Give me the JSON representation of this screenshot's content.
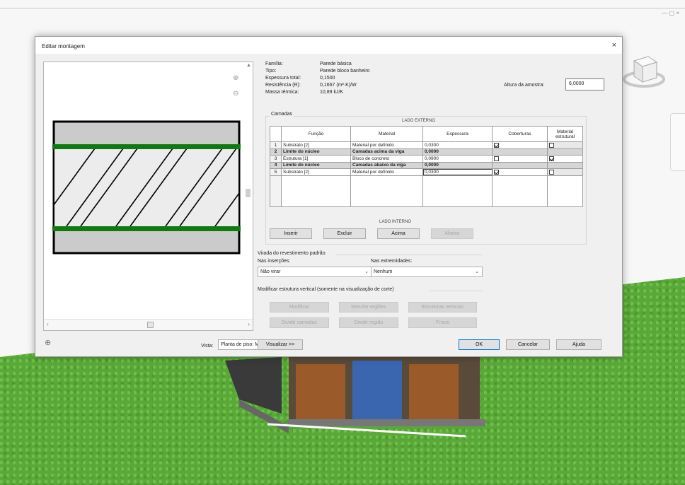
{
  "window": {
    "controls": "— ▢ ×"
  },
  "dialog": {
    "title": "Editar montagem",
    "close": "×"
  },
  "properties": {
    "labels": [
      "Família:",
      "Tipo:",
      "Espessura total:",
      "Resistência (R):",
      "Massa térmica:"
    ],
    "values": [
      "Parede básica",
      "Parede bloco banheiro",
      "0,1500",
      "0,1667 (m²·K)/W",
      "10,89 kJ/K"
    ],
    "sample_height_label": "Altura da amostra:",
    "sample_height_value": "6,0000"
  },
  "layers": {
    "group_label": "Camadas",
    "exterior_side": "LADO EXTERNO",
    "interior_side": "LADO INTERNO",
    "headers": [
      "",
      "Função",
      "Material",
      "Espessura",
      "Coberturas",
      "Material estrutural"
    ],
    "rows": [
      {
        "num": "1",
        "function": "Substrato [2]",
        "material": "Material por definido",
        "thickness": "0,0300",
        "wraps": true,
        "structural": false,
        "core": false
      },
      {
        "num": "2",
        "function": "Limite do núcleo",
        "material": "Camadas acima da viga",
        "thickness": "0,0000",
        "wraps": null,
        "structural": null,
        "core": true
      },
      {
        "num": "3",
        "function": "Estrutura [1]",
        "material": "Bloco de concreto",
        "thickness": "0,0900",
        "wraps": false,
        "structural": true,
        "core": false
      },
      {
        "num": "4",
        "function": "Limite do núcleo",
        "material": "Camadas abaixo da viga",
        "thickness": "0,0000",
        "wraps": null,
        "structural": null,
        "core": true
      },
      {
        "num": "5",
        "function": "Substrato [2]",
        "material": "Material por definido",
        "thickness": "0,0300",
        "wraps": true,
        "structural": false,
        "core": false
      }
    ],
    "buttons": {
      "insert": "Inserir",
      "delete": "Excluir",
      "up": "Acima",
      "down": "Abaixo"
    }
  },
  "wrapping": {
    "title": "Virada do revestimento padrão",
    "at_inserts_label": "Nas inserções:",
    "at_inserts_value": "Não virar",
    "at_ends_label": "Nas extremidades:",
    "at_ends_value": "Nenhum"
  },
  "vertical": {
    "title": "Modificar estrutura vertical (somente na visualização de corte)",
    "buttons": [
      "Modificar",
      "Mesclar regiões",
      "Estruturas verticais",
      "Dividir camadas",
      "Dividir região",
      "Frisos"
    ]
  },
  "footer": {
    "view_label": "Vista:",
    "view_value": "Planta de piso: Modif",
    "preview_button": "Visualizar >>",
    "ok": "OK",
    "cancel": "Cancelar",
    "help": "Ajuda"
  },
  "colors": {
    "core_boundary": "#0f7a0f",
    "core_row_bg": "#d5d5d5",
    "ok_border": "#0078d7",
    "grass": "#5aa83a"
  }
}
